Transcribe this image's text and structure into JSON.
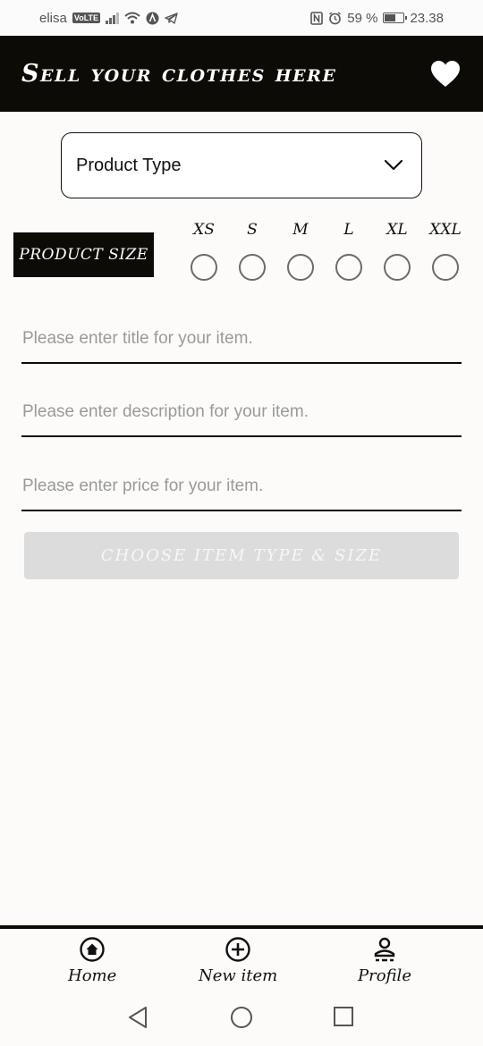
{
  "status_bar": {
    "carrier": "elisa",
    "volte": "VoLTE",
    "battery_percent": "59 %",
    "battery_level": 0.59,
    "time": "23.38",
    "icons": [
      "signal-icon",
      "wifi-icon",
      "app-a-icon",
      "telegram-icon",
      "nfc-icon",
      "alarm-icon",
      "battery-icon"
    ]
  },
  "header": {
    "title": "Sell your clothes here",
    "favorite_icon": "heart-icon"
  },
  "form": {
    "product_type": {
      "selected": "Product Type",
      "icon": "chevron-down-icon"
    },
    "size": {
      "label": "PRODUCT SIZE",
      "options": [
        "XS",
        "S",
        "M",
        "L",
        "XL",
        "XXL"
      ]
    },
    "title_field": {
      "placeholder": "Please enter title for your item.",
      "value": ""
    },
    "description_field": {
      "placeholder": "Please enter description for your item.",
      "value": ""
    },
    "price_field": {
      "placeholder": "Please enter price for your item.",
      "value": ""
    },
    "submit_label": "CHOOSE ITEM TYPE & SIZE"
  },
  "bottom_nav": {
    "items": [
      {
        "label": "Home",
        "icon": "home-icon"
      },
      {
        "label": "New item",
        "icon": "add-circle-icon"
      },
      {
        "label": "Profile",
        "icon": "profile-icon"
      }
    ]
  },
  "system_nav": {
    "icons": [
      "back-icon",
      "home-circle-icon",
      "recents-icon"
    ]
  },
  "colors": {
    "header_bg": "#0d0b06",
    "page_bg": "#fcfbfa",
    "disabled_button": "#dcdcdc",
    "placeholder": "#9a9a9a"
  }
}
